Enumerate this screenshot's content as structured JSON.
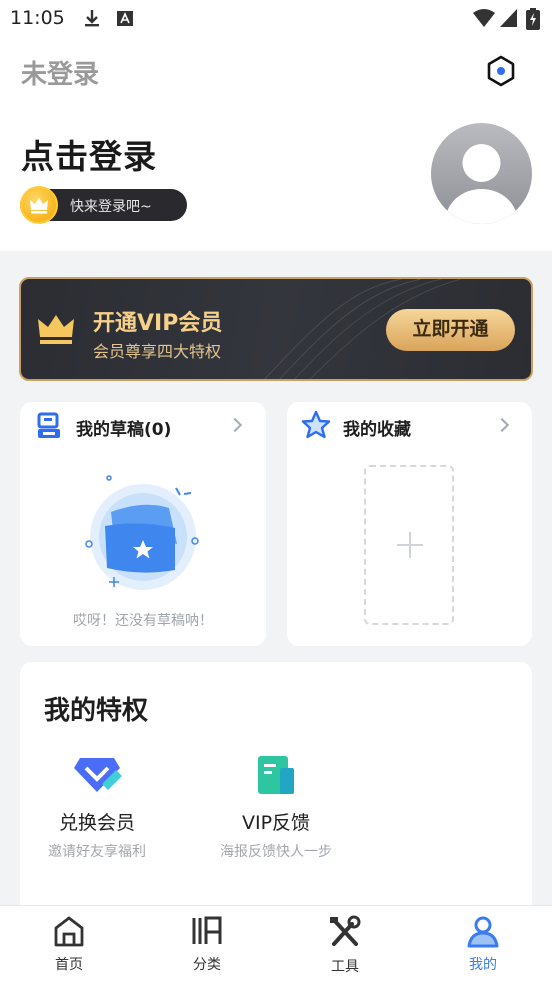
{
  "status_bar": {
    "time": "11:05"
  },
  "header": {
    "title": "未登录"
  },
  "profile": {
    "login_title": "点击登录",
    "coin_hint": "快来登录吧~"
  },
  "vip": {
    "title": "开通VIP会员",
    "subtitle": "会员尊享四大特权",
    "button": "立即开通"
  },
  "drafts": {
    "title": "我的草稿(0)",
    "empty_text": "哎呀！还没有草稿呐！"
  },
  "favorites": {
    "title": "我的收藏"
  },
  "privileges": {
    "title": "我的特权",
    "items": [
      {
        "name": "兑换会员",
        "desc": "邀请好友享福利",
        "icon": "exchange-vip-icon"
      },
      {
        "name": "VIP反馈",
        "desc": "海报反馈快人一步",
        "icon": "feedback-icon"
      }
    ]
  },
  "nav": [
    {
      "label": "首页",
      "icon": "home-icon"
    },
    {
      "label": "分类",
      "icon": "category-icon"
    },
    {
      "label": "工具",
      "icon": "tools-icon"
    },
    {
      "label": "我的",
      "icon": "profile-icon",
      "active": true
    }
  ],
  "colors": {
    "accent": "#3a7bf0",
    "vip_gold": "#f7d08a",
    "vip_bg": "#2b2d33"
  }
}
